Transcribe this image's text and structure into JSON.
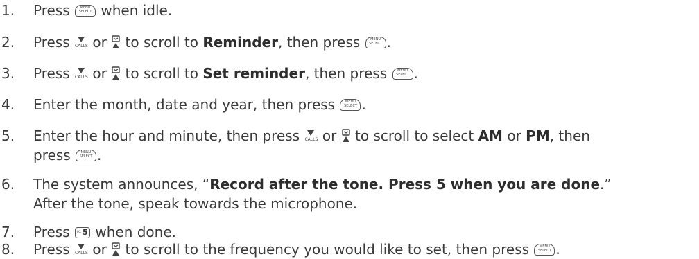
{
  "icons": {
    "menu_top": "MENU",
    "menu_bottom": "SELECT",
    "calls": "CALLS",
    "jkl": "JKL",
    "five": "5"
  },
  "steps": [
    {
      "num": "1.",
      "parts": [
        "Press",
        "when idle."
      ]
    },
    {
      "num": "2.",
      "parts": [
        "Press",
        "or",
        "to scroll to",
        "Reminder",
        ", then press",
        "."
      ]
    },
    {
      "num": "3.",
      "parts": [
        "Press",
        "or",
        "to scroll to",
        "Set reminder",
        ", then press",
        "."
      ]
    },
    {
      "num": "4.",
      "parts": [
        "Enter the month, date and year, then press",
        "."
      ]
    },
    {
      "num": "5.",
      "parts": [
        "Enter the hour and minute, then press",
        "or",
        "to scroll to select",
        "AM",
        "or",
        "PM",
        ", then",
        "press",
        "."
      ]
    },
    {
      "num": "6.",
      "parts": [
        "The system announces, “",
        "Record after the tone. Press 5 when you are done",
        ".”",
        "After the tone, speak towards the microphone."
      ]
    },
    {
      "num": "7.",
      "parts": [
        "Press",
        "when done."
      ]
    },
    {
      "num": "8.",
      "parts": [
        "Press",
        "or",
        "to scroll to the frequency you would like to set, then press",
        "."
      ]
    }
  ]
}
